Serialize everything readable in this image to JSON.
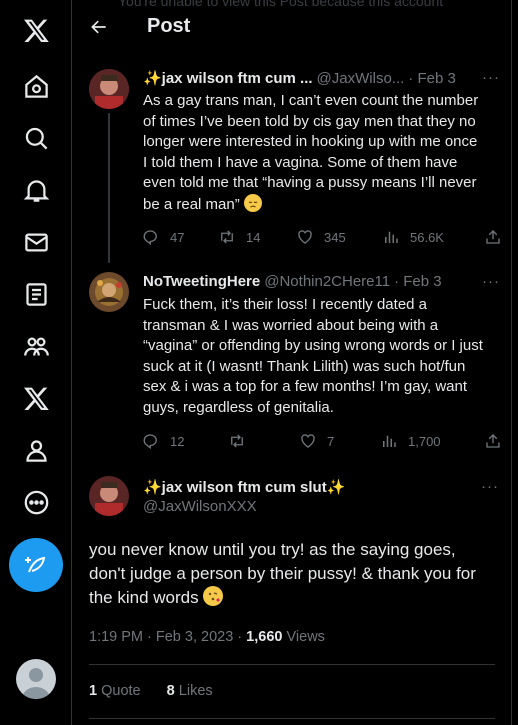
{
  "nav": {
    "items": [
      "x-logo-icon",
      "home-icon",
      "search-icon",
      "notifications-icon",
      "messages-icon",
      "lists-icon",
      "communities-icon",
      "premium-icon",
      "profile-icon",
      "more-icon"
    ]
  },
  "header": {
    "title": "Post",
    "ghost_text": "You're unable to view this Post because this account"
  },
  "tweets": [
    {
      "name": "✨jax wilson ftm cum ...",
      "handle": "@JaxWilso...",
      "date": "· Feb 3",
      "text": "As a gay trans man, I can’t even count the number of times I’ve been told by cis gay men that they no longer were interested in hooking up with me once I told them I have a vagina. Some of them have even told me that “having a pussy means I’ll never be a real man”",
      "emoji": "pensive-face-emoji",
      "replies": "47",
      "reposts": "14",
      "likes": "345",
      "views": "56.6K"
    },
    {
      "name": "NoTweetingHere",
      "handle": "@Nothin2CHere11",
      "date": "· Feb 3",
      "text": "Fuck them, it’s their loss! I recently dated a transman & I was worried about being with a “vagina” or offending by using wrong words or I just suck at it (I wasnt! Thank Lilith) was such hot/fun sex & i was a top for a few months! I’m gay, want guys, regardless of genitalia.",
      "replies": "12",
      "reposts": "",
      "likes": "7",
      "views": "1,700"
    }
  ],
  "focused": {
    "name": "✨jax wilson ftm cum slut✨",
    "handle": "@JaxWilsonXXX",
    "text": "you never know until you try! as the saying goes, don't judge a person by their pussy! & thank you for the kind words",
    "emoji": "face-blowing-kiss-emoji",
    "time": "1:19 PM · Feb 3, 2023 · ",
    "views_count": "1,660",
    "views_label": " Views",
    "quotes_count": "1",
    "quotes_label": " Quote",
    "likes_count": "8",
    "likes_label": " Likes"
  },
  "colors": {
    "accent": "#1d9bf0",
    "background": "#000000",
    "text": "#e7e9ea",
    "muted": "#71767b"
  }
}
